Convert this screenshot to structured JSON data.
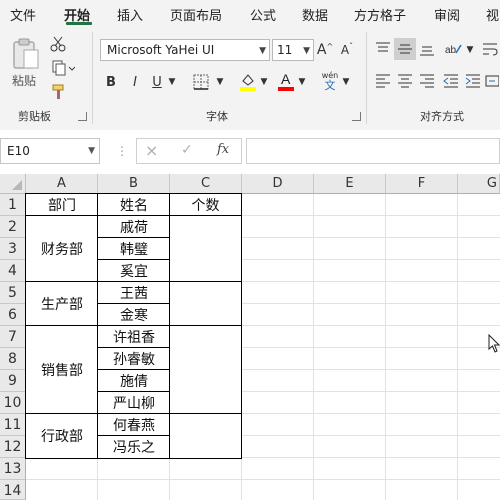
{
  "ribbon": {
    "tabs": [
      "文件",
      "开始",
      "插入",
      "页面布局",
      "公式",
      "数据",
      "方方格子",
      "审阅",
      "视"
    ],
    "active_tab": "开始",
    "clipboard": {
      "paste_label": "粘贴",
      "group_label": "剪贴板"
    },
    "font": {
      "family": "Microsoft YaHei UI",
      "size": "11",
      "group_label": "字体",
      "bold": "B",
      "italic": "I",
      "underline": "U",
      "grow": "A",
      "shrink": "A",
      "phonetic_top": "wén",
      "phonetic_bottom": "文"
    },
    "alignment": {
      "group_label": "对齐方式"
    },
    "accent_color": "#217346",
    "highlight_color": "#ffff00",
    "font_color": "#ff0000"
  },
  "formula_bar": {
    "name_box": "E10",
    "cancel_icon": "×",
    "enter_icon": "✓",
    "fx_label": "fx",
    "formula": ""
  },
  "sheet": {
    "columns": [
      "A",
      "B",
      "C",
      "D",
      "E",
      "F",
      "G"
    ],
    "rows": [
      "1",
      "2",
      "3",
      "4",
      "5",
      "6",
      "7",
      "8",
      "9",
      "10",
      "11",
      "12",
      "13",
      "14"
    ],
    "header": {
      "dept": "部门",
      "name": "姓名",
      "count": "个数"
    },
    "departments": [
      "财务部",
      "生产部",
      "销售部",
      "行政部"
    ],
    "names": [
      "戚荷",
      "韩璧",
      "奚宜",
      "王茜",
      "金寒",
      "许祖香",
      "孙睿敏",
      "施倩",
      "严山柳",
      "何春燕",
      "冯乐之"
    ]
  }
}
